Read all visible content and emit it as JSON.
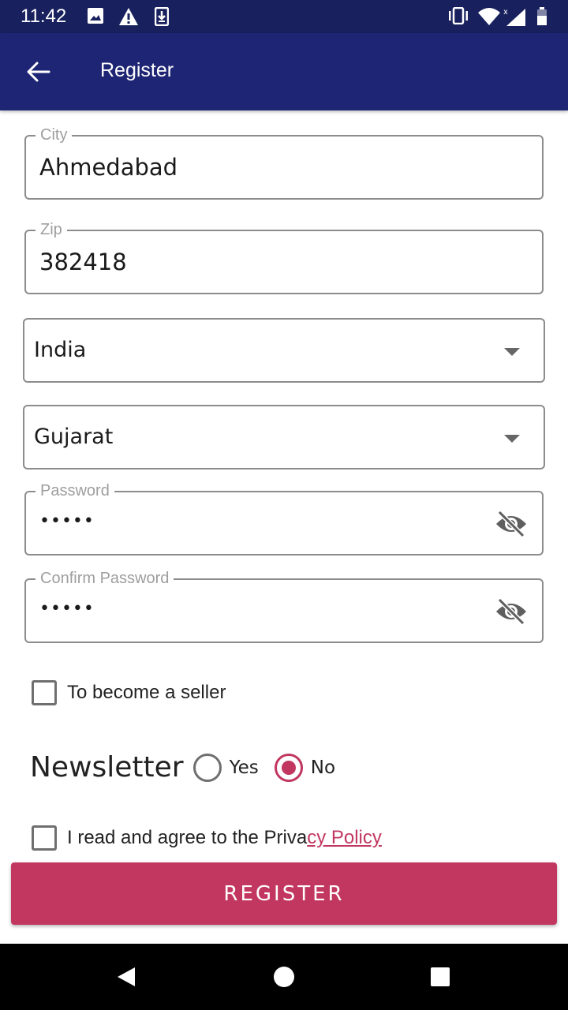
{
  "status_bar": {
    "time": "11:42",
    "icons": [
      "image-icon",
      "warning-icon",
      "download-icon",
      "vibrate-icon",
      "wifi-icon",
      "signal-icon",
      "battery-icon"
    ]
  },
  "app_bar": {
    "title": "Register",
    "back_icon": "arrow-back-icon",
    "background": "#1e2574"
  },
  "form": {
    "city": {
      "label": "City",
      "value": "Ahmedabad"
    },
    "zip": {
      "label": "Zip",
      "value": "382418"
    },
    "country": {
      "value": "India"
    },
    "state": {
      "value": "Gujarat"
    },
    "password": {
      "label": "Password",
      "value": "•••••"
    },
    "confirm_password": {
      "label": "Confirm Password",
      "value": "•••••"
    },
    "seller_checkbox": {
      "label": "To become a seller",
      "checked": false
    },
    "newsletter": {
      "title": "Newsletter",
      "options": [
        {
          "label": "Yes",
          "selected": false
        },
        {
          "label": "No",
          "selected": true
        }
      ]
    },
    "privacy": {
      "prefix": "I read and agree to the Priva",
      "link": "cy Policy ",
      "checked": false
    }
  },
  "register_button": {
    "label": "REGISTER",
    "color": "#c2375f"
  },
  "nav_bar": {
    "icons": [
      "back-triangle-icon",
      "home-circle-icon",
      "recents-square-icon"
    ]
  }
}
